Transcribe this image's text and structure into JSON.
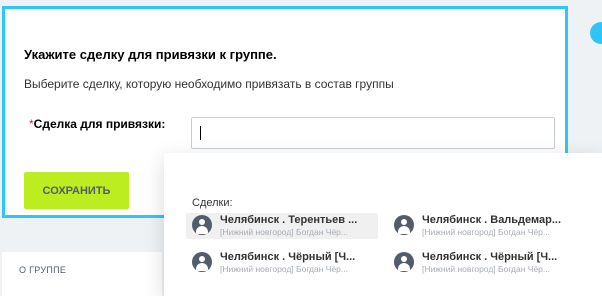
{
  "dialog": {
    "title": "Укажите сделку для привязки к группе.",
    "description": "Выберите сделку, которую необходимо привязать в состав группы",
    "field_required_mark": "*",
    "field_label": "Сделка для привязки:",
    "field_value": "",
    "save_label": "СОХРАНИТЬ"
  },
  "side_panel": {
    "title": "О ГРУППЕ"
  },
  "popup": {
    "title": "Сделки:",
    "items": [
      {
        "name": "Челябинск . Терентьев ...",
        "sub": "[Нижний новгород] Богдан Чёр...",
        "selected": true
      },
      {
        "name": "Челябинск . Вальдемар...",
        "sub": "[Нижний новгород] Богдан Чёр...",
        "selected": false
      },
      {
        "name": "Челябинск . Чёрный [Ч...",
        "sub": "[Нижний новгород] Богдан Чёр...",
        "selected": false
      },
      {
        "name": "Челябинск . Чёрный [Ч...",
        "sub": "[Нижний новгород] Богдан Чёр...",
        "selected": false
      }
    ]
  },
  "colors": {
    "accent": "#2fc6f6",
    "save_button": "#bbed21",
    "required": "#e02020",
    "avatar": "#535c69"
  },
  "icons": {
    "deal_avatar": "user-avatar-icon"
  }
}
